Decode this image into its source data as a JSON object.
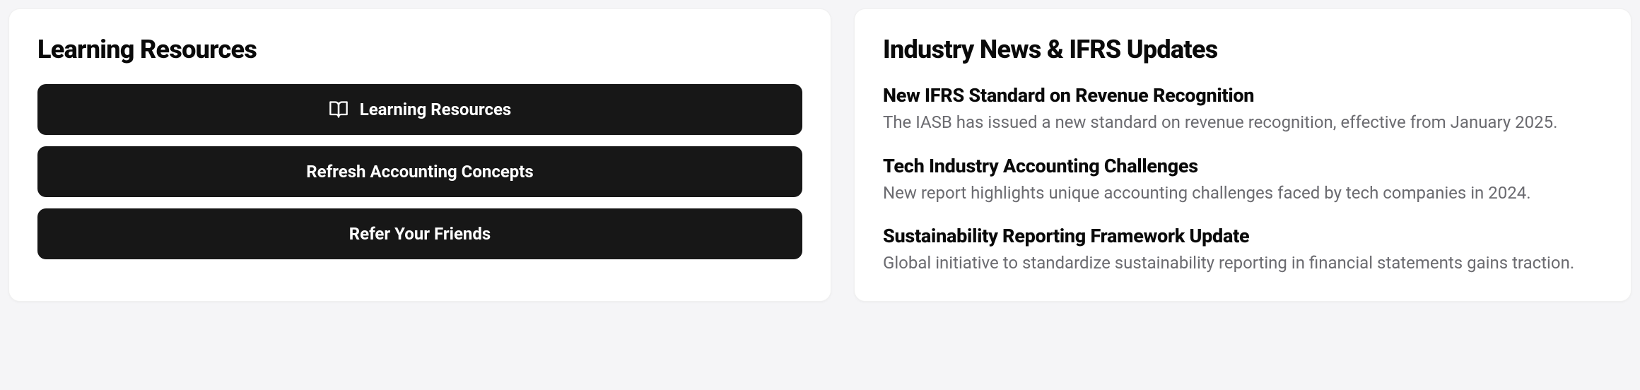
{
  "left": {
    "title": "Learning Resources",
    "buttons": [
      {
        "label": "Learning Resources",
        "icon": "book-open-icon"
      },
      {
        "label": "Refresh Accounting Concepts"
      },
      {
        "label": "Refer Your Friends"
      }
    ]
  },
  "right": {
    "title": "Industry News & IFRS Updates",
    "news": [
      {
        "title": "New IFRS Standard on Revenue Recognition",
        "desc": "The IASB has issued a new standard on revenue recognition, effective from January 2025."
      },
      {
        "title": "Tech Industry Accounting Challenges",
        "desc": "New report highlights unique accounting challenges faced by tech companies in 2024."
      },
      {
        "title": "Sustainability Reporting Framework Update",
        "desc": "Global initiative to standardize sustainability reporting in financial statements gains traction."
      }
    ]
  }
}
